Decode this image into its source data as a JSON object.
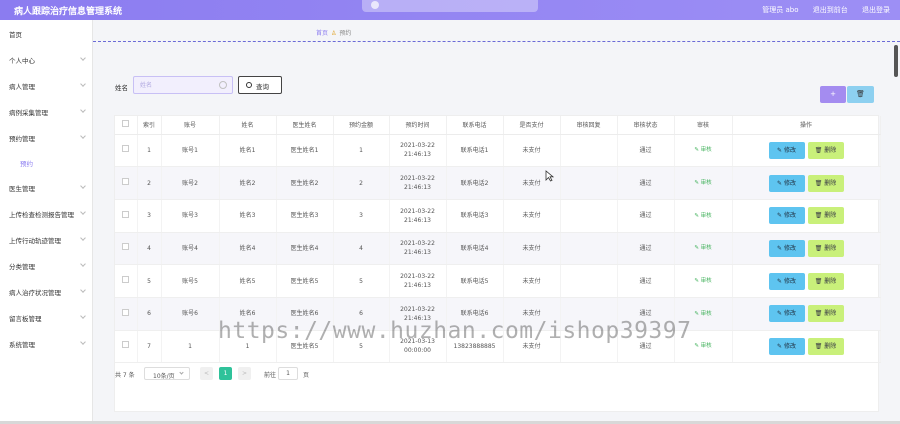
{
  "app": {
    "title": "病人跟踪治疗信息管理系统",
    "user_label": "管理员 abo",
    "back_label": "退出到前台",
    "logout_label": "退出登录"
  },
  "sidebar": {
    "items": [
      {
        "label": "首页",
        "has_arrow": false
      },
      {
        "label": "个人中心",
        "has_arrow": true
      },
      {
        "label": "病人管理",
        "has_arrow": true
      },
      {
        "label": "病例采集管理",
        "has_arrow": true
      },
      {
        "label": "预约管理",
        "has_arrow": true
      },
      {
        "label": "预约",
        "sub": true
      },
      {
        "label": "医生管理",
        "has_arrow": true
      },
      {
        "label": "上传检查检测报告管理",
        "has_arrow": true
      },
      {
        "label": "上传行动轨迹管理",
        "has_arrow": true
      },
      {
        "label": "分类管理",
        "has_arrow": true
      },
      {
        "label": "病人治疗状况管理",
        "has_arrow": true
      },
      {
        "label": "留言板管理",
        "has_arrow": true
      },
      {
        "label": "系统管理",
        "has_arrow": true
      }
    ]
  },
  "breadcrumb": {
    "home": "首页",
    "current": "预约"
  },
  "search": {
    "label": "姓名",
    "placeholder": "姓名",
    "button_label": "查询"
  },
  "toolbar": {
    "add_label": "+",
    "delete_label": "🗑"
  },
  "table": {
    "headers": [
      "",
      "索引",
      "账号",
      "姓名",
      "医生姓名",
      "预约金额",
      "预约时间",
      "联系电话",
      "是否支付",
      "审核回复",
      "审核状态",
      "审核",
      "操作"
    ],
    "edit_label": "修改",
    "delete_label": "删除",
    "audit_label": "审核",
    "rows": [
      {
        "index": "1",
        "account": "账号1",
        "name": "姓名1",
        "doctor": "医生姓名1",
        "amount": "1",
        "time": "2021-03-22 21:46:13",
        "phone": "联系电话1",
        "paid": "未支付",
        "reply": "",
        "status": "通过"
      },
      {
        "index": "2",
        "account": "账号2",
        "name": "姓名2",
        "doctor": "医生姓名2",
        "amount": "2",
        "time": "2021-03-22 21:46:13",
        "phone": "联系电话2",
        "paid": "未支付",
        "reply": "",
        "status": "通过"
      },
      {
        "index": "3",
        "account": "账号3",
        "name": "姓名3",
        "doctor": "医生姓名3",
        "amount": "3",
        "time": "2021-03-22 21:46:13",
        "phone": "联系电话3",
        "paid": "未支付",
        "reply": "",
        "status": "通过"
      },
      {
        "index": "4",
        "account": "账号4",
        "name": "姓名4",
        "doctor": "医生姓名4",
        "amount": "4",
        "time": "2021-03-22 21:46:13",
        "phone": "联系电话4",
        "paid": "未支付",
        "reply": "",
        "status": "通过"
      },
      {
        "index": "5",
        "account": "账号5",
        "name": "姓名5",
        "doctor": "医生姓名5",
        "amount": "5",
        "time": "2021-03-22 21:46:13",
        "phone": "联系电话5",
        "paid": "未支付",
        "reply": "",
        "status": "通过"
      },
      {
        "index": "6",
        "account": "账号6",
        "name": "姓名6",
        "doctor": "医生姓名6",
        "amount": "6",
        "time": "2021-03-22 21:46:13",
        "phone": "联系电话6",
        "paid": "未支付",
        "reply": "",
        "status": "通过"
      },
      {
        "index": "7",
        "account": "1",
        "name": "1",
        "doctor": "医生姓名5",
        "amount": "5",
        "time": "2021-03-13 00:00:00",
        "phone": "13823888885",
        "paid": "未支付",
        "reply": "",
        "status": "通过"
      }
    ]
  },
  "pagination": {
    "total": "共 7 条",
    "page_size": "10条/页",
    "prev": "<",
    "current_page": "1",
    "next": ">",
    "goto_label": "前往",
    "goto_value": "1",
    "page_word": "页"
  },
  "watermark": "https://www.huzhan.com/ishop39397",
  "colors": {
    "accent": "#8b7cf0",
    "edit": "#5ec4f0",
    "delete": "#c9f07a",
    "active_page": "#2fc29a"
  }
}
